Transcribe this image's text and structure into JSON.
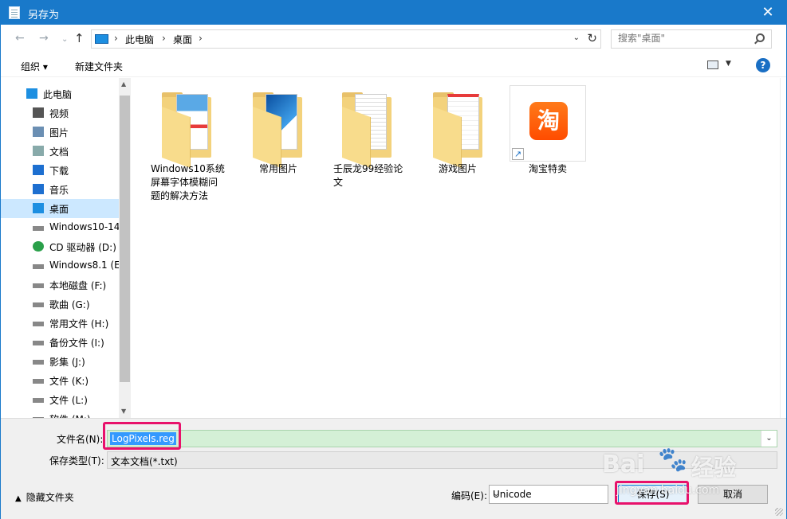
{
  "titlebar": {
    "title": "另存为",
    "close": "✕"
  },
  "navbar": {
    "back": "←",
    "forward": "→",
    "recent": "⌄",
    "up": "↑",
    "path": [
      "此电脑",
      "桌面"
    ],
    "separator": "›",
    "search_placeholder": "搜索\"桌面\""
  },
  "toolbar": {
    "organize": "组织 ▾",
    "new_folder": "新建文件夹",
    "help": "?"
  },
  "nav_pane": {
    "items": [
      {
        "label": "此电脑",
        "icon": "computer-icon"
      },
      {
        "label": "视频",
        "icon": "video-icon"
      },
      {
        "label": "图片",
        "icon": "pictures-icon"
      },
      {
        "label": "文档",
        "icon": "documents-icon"
      },
      {
        "label": "下载",
        "icon": "download-icon"
      },
      {
        "label": "音乐",
        "icon": "music-icon"
      },
      {
        "label": "桌面",
        "icon": "desktop-icon",
        "selected": true
      },
      {
        "label": "Windows10-14",
        "icon": "drive-icon"
      },
      {
        "label": "CD 驱动器 (D:)",
        "icon": "cd-drive-icon"
      },
      {
        "label": "Windows8.1 (E",
        "icon": "drive-icon"
      },
      {
        "label": "本地磁盘 (F:)",
        "icon": "drive-icon"
      },
      {
        "label": "歌曲 (G:)",
        "icon": "drive-icon"
      },
      {
        "label": "常用文件 (H:)",
        "icon": "drive-icon"
      },
      {
        "label": "备份文件 (I:)",
        "icon": "drive-icon"
      },
      {
        "label": "影集 (J:)",
        "icon": "drive-icon"
      },
      {
        "label": "文件 (K:)",
        "icon": "drive-icon"
      },
      {
        "label": "文件 (L:)",
        "icon": "drive-icon"
      },
      {
        "label": "软件 (M:)",
        "icon": "drive-icon"
      }
    ]
  },
  "files": [
    {
      "label_lines": [
        "Windows10系统",
        "屏幕字体模糊问",
        "题的解决方法"
      ],
      "type": "folder"
    },
    {
      "label_lines": [
        "常用图片"
      ],
      "type": "folder"
    },
    {
      "label_lines": [
        "壬辰龙99经验论",
        "文"
      ],
      "type": "folder"
    },
    {
      "label_lines": [
        "游戏图片"
      ],
      "type": "folder"
    },
    {
      "label_lines": [
        "淘宝特卖"
      ],
      "type": "shortcut",
      "icon_text": "淘"
    }
  ],
  "form": {
    "filename_label": "文件名(N):",
    "filename_value": "LogPixels.reg",
    "filetype_label": "保存类型(T):",
    "filetype_value": "文本文档(*.txt)",
    "encoding_label": "编码(E):",
    "encoding_value": "Unicode",
    "save_button": "保存(S)",
    "cancel_button": "取消",
    "hide_folders": "隐藏文件夹"
  },
  "watermark": {
    "logo": "Bai",
    "logo_cn": "经验",
    "url": "jingyan.baidu.com"
  },
  "colors": {
    "accent": "#1979ca",
    "highlight": "#e8116b",
    "selection": "#cce8ff"
  }
}
